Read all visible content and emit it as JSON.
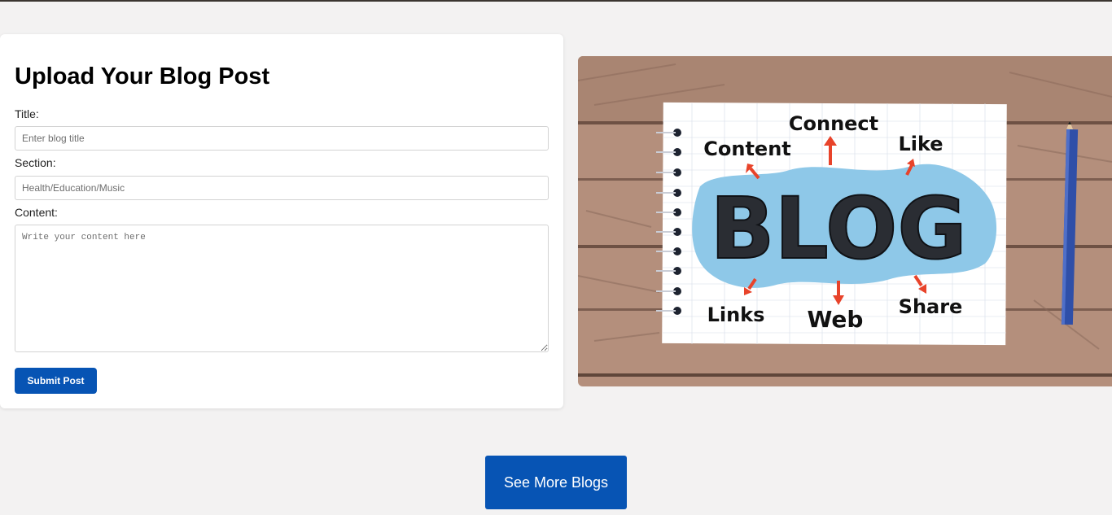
{
  "form": {
    "heading": "Upload Your Blog Post",
    "title_label": "Title:",
    "title_placeholder": "Enter blog title",
    "title_value": "",
    "section_label": "Section:",
    "section_placeholder": "Health/Education/Music",
    "section_value": "",
    "content_label": "Content:",
    "content_placeholder": "Write your content here",
    "content_value": "",
    "submit_label": "Submit Post"
  },
  "illustration": {
    "main_word": "BLOG",
    "words": [
      "Connect",
      "Content",
      "Like",
      "Links",
      "Web",
      "Share"
    ]
  },
  "footer": {
    "more_label": "See More Blogs"
  },
  "colors": {
    "page_bg": "#f3f2f2",
    "card_bg": "#ffffff",
    "primary": "#0754b4",
    "paper_splash": "#8ec8e8",
    "arrow": "#e8432a",
    "pencil": "#2f4fa8"
  }
}
